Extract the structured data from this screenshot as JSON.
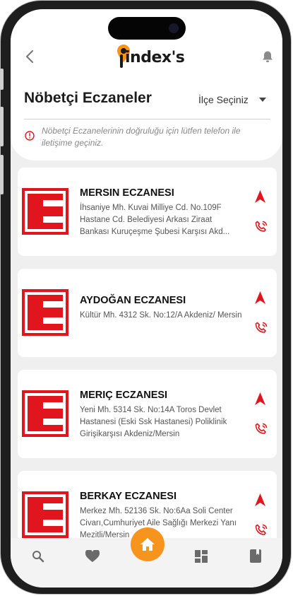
{
  "header": {
    "brand": "index's",
    "title": "Nöbetçi Eczaneler",
    "district_select": "İlçe Seçiniz",
    "info": "Nöbetçi Eczanelerinin doğruluğu için lütfen telefon ile iletişime geçiniz."
  },
  "pharmacies": [
    {
      "name": "MERSIN ECZANESI",
      "address": "İhsaniye Mh. Kuvai Milliye Cd. No.109F Hastane Cd. Belediyesi Arkası Ziraat Bankası Kuruçeşme Şubesi Karşısı Akd..."
    },
    {
      "name": "AYDOĞAN ECZANESI",
      "address": "Kültür Mh. 4312 Sk. No:12/A Akdeniz/ Mersin"
    },
    {
      "name": "MERIÇ ECZANESI",
      "address": "Yeni Mh. 5314 Sk. No:14A Toros Devlet Hastanesi (Eski Ssk Hastanesi) Poliklinik Girişikarşısı Akdeniz/Mersin"
    },
    {
      "name": "BERKAY ECZANESI",
      "address": "Merkez Mh. 52136 Sk. No:6Aa Soli Center Civarı,Cumhuriyet Aile Sağlığı Merkezi Yanı Mezitli/Mersin"
    }
  ],
  "colors": {
    "accent_red": "#e1151e",
    "home_orange": "#f7941d",
    "nav_icon_gray": "#6a6a6a"
  },
  "icons": {
    "back": "chevron-left-icon",
    "notifications": "bell-icon",
    "dropdown": "caret-down-icon",
    "info": "info-circle-icon",
    "navigate": "navigation-arrow-icon",
    "call": "phone-call-icon",
    "nav": [
      "search-icon",
      "heart-icon",
      "home-icon",
      "dashboard-icon",
      "book-icon"
    ]
  }
}
